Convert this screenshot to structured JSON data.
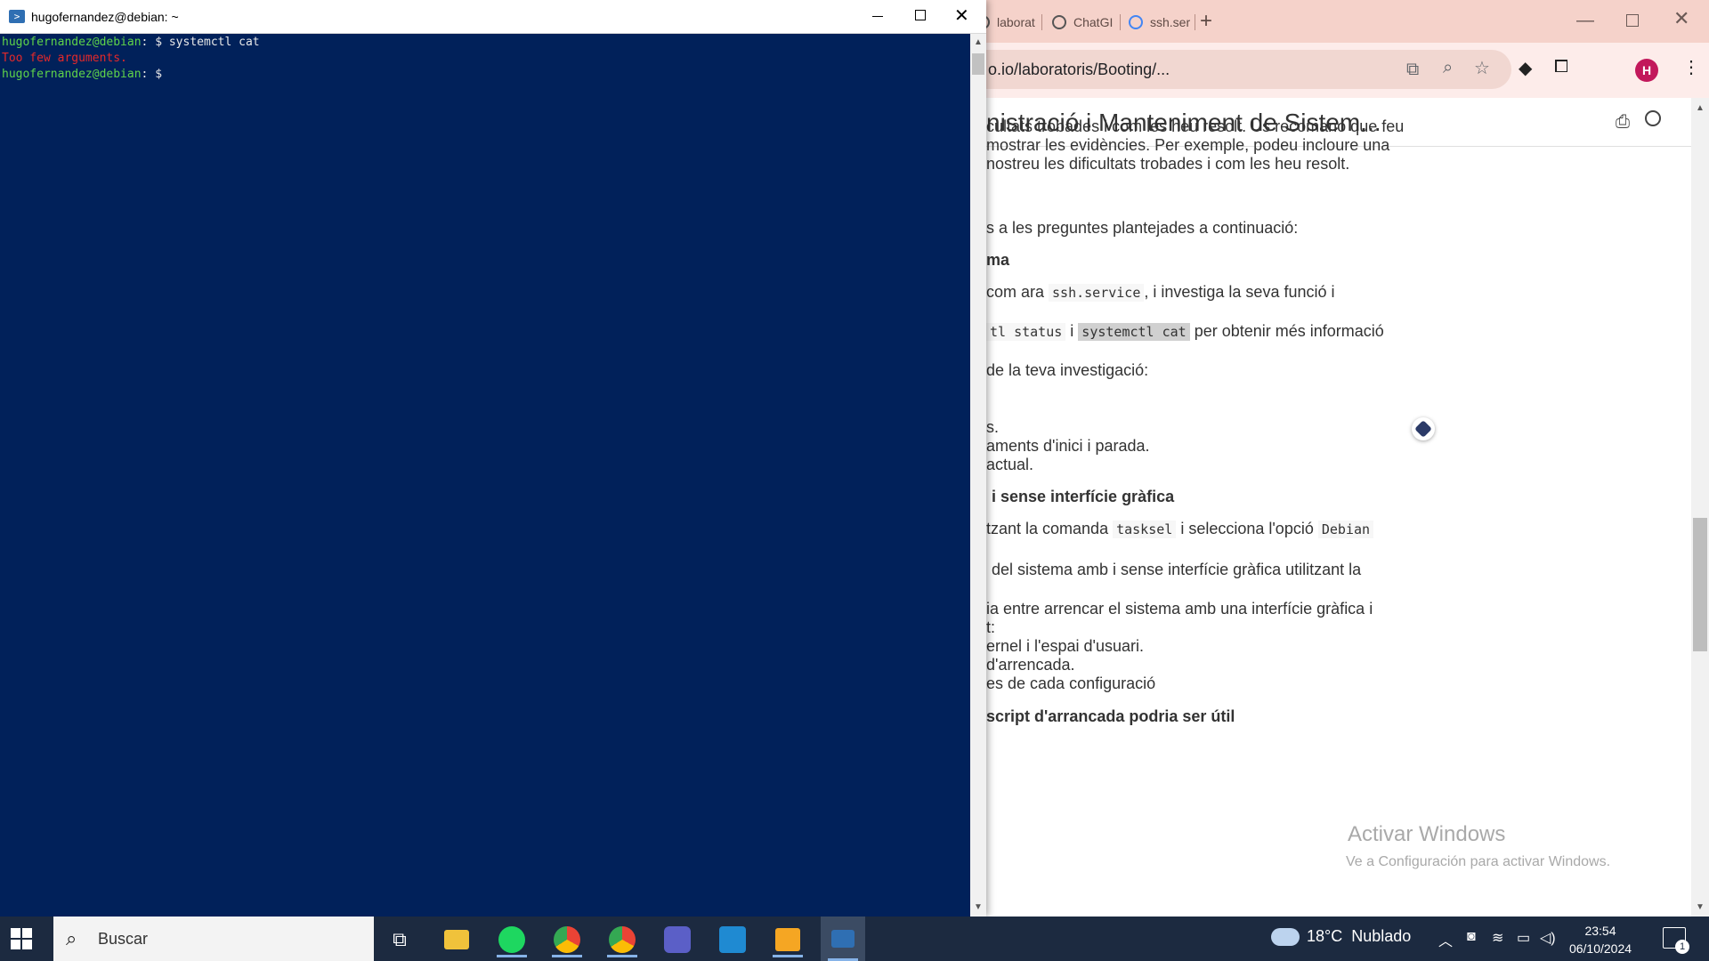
{
  "terminal": {
    "title": "hugofernandez@debian: ~",
    "lines": [
      {
        "user": "hugofernandez@debian",
        "rest": ": $ systemctl cat"
      },
      {
        "error": "Too few arguments."
      },
      {
        "user": "hugofernandez@debian",
        "rest": ": $"
      }
    ]
  },
  "browser": {
    "tabs": [
      {
        "label": "laborat"
      },
      {
        "label": "ChatGI"
      },
      {
        "label": "ssh.ser"
      }
    ],
    "new_tab": "+",
    "url": "o.io/laboratoris/Booting/...",
    "profile_initial": "H",
    "page_title": "nistració i Manteniment de Sistem...",
    "content": {
      "l1": "cultats trobades i com les heu resolt. Us recomano que feu",
      "l2": "mostrar les evidències. Per exemple, podeu incloure una",
      "l3": "nostreu les dificultats trobades i com les heu resolt.",
      "l4": "s a les preguntes plantejades a continuació:",
      "h1": "ma",
      "l5a": "com ara ",
      "l5code": "ssh.service",
      "l5b": ", i investiga la seva funció i",
      "l6code1": "tl status",
      "l6a": " i ",
      "l6code2": "systemctl cat",
      "l6b": " per obtenir més informació",
      "l7": "de la teva investigació:",
      "l8": "s.",
      "l9": "aments d'inici i parada.",
      "l10": "actual.",
      "h2": "i sense interfície gràfica",
      "l11a": "tzant la comanda ",
      "l11code": "tasksel",
      "l11b": " i selecciona l'opció ",
      "l11code2": "Debian",
      "l12": "del sistema amb i sense interfície gràfica utilitzant la",
      "l13": "ia entre arrencar el sistema amb una interfície gràfica i",
      "l14": "t:",
      "l15": "ernel i l'espai d'usuari.",
      "l16": "d'arrencada.",
      "l17": "es de cada configuració",
      "h3": "script d'arrancada podria ser útil"
    }
  },
  "activation": {
    "title": "Activar Windows",
    "subtitle": "Ve a Configuración para activar Windows."
  },
  "taskbar": {
    "search_placeholder": "Buscar",
    "weather_temp": "18°C",
    "weather_desc": "Nublado",
    "time": "23:54",
    "date": "06/10/2024",
    "notification_count": "1",
    "apps": [
      "task-view",
      "file-explorer",
      "spotify",
      "chrome",
      "chrome-profile",
      "teams",
      "vscode",
      "remote-desktop",
      "terminal"
    ]
  },
  "colors": {
    "terminal_bg": "#01215a",
    "prompt_user": "#5fd34a",
    "error_text": "#e62929",
    "chrome_tabbar": "#f5d2ca",
    "taskbar": "#1c2a40"
  }
}
